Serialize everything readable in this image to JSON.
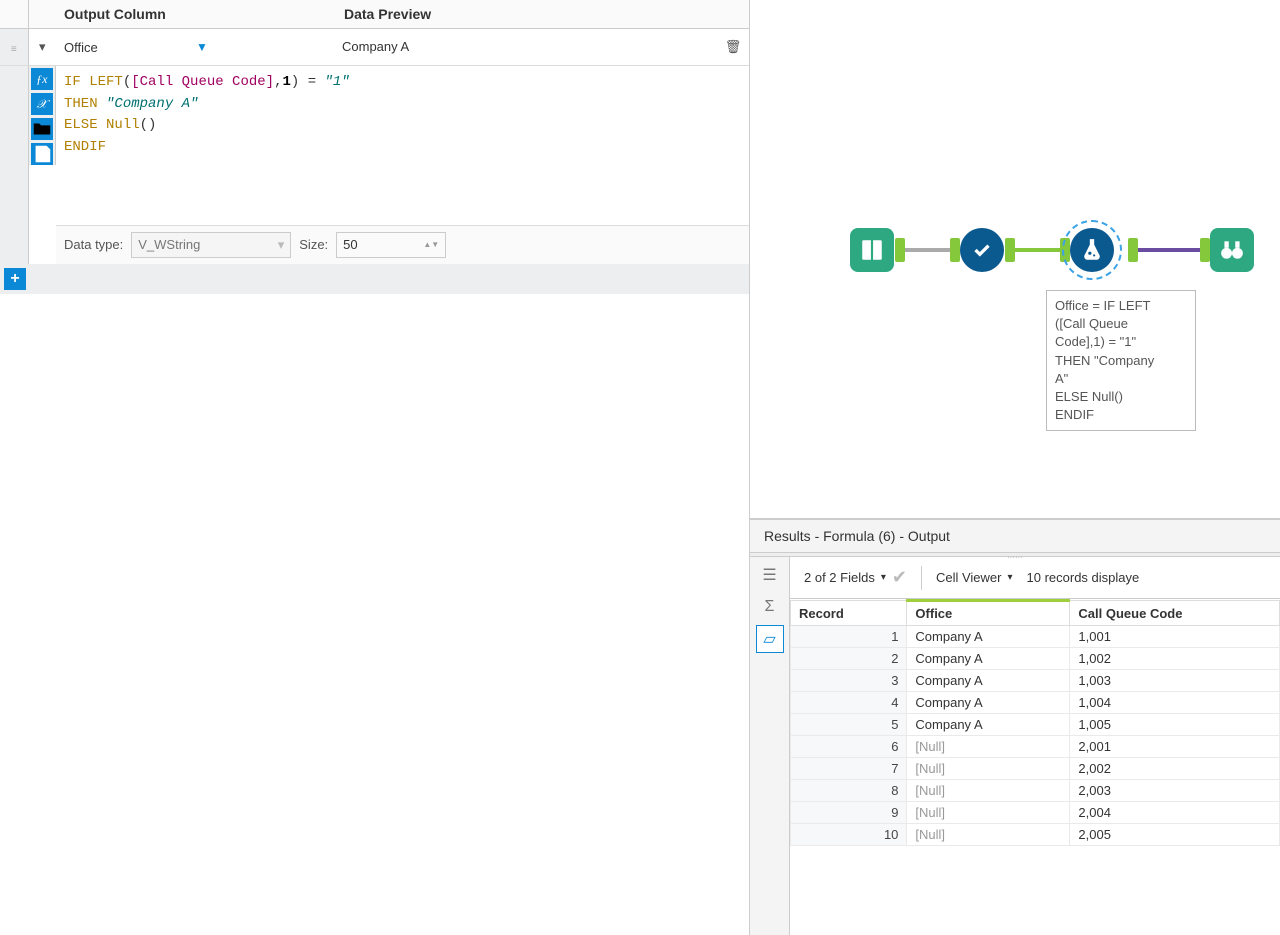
{
  "config": {
    "headers": {
      "output_column": "Output Column",
      "data_preview": "Data Preview"
    },
    "output_column_value": "Office",
    "data_preview_value": "Company A",
    "formula": {
      "kw_if": "IF",
      "fn_left": "LEFT",
      "field": "[Call Queue Code]",
      "comma": ",",
      "num1": "1",
      "eq": "=",
      "str1": "\"1\"",
      "kw_then": "THEN",
      "str_company": "\"Company A\"",
      "kw_else": "ELSE",
      "fn_null": "Null",
      "parens": "()",
      "kw_endif": "ENDIF"
    },
    "datatype_label": "Data type:",
    "datatype_value": "V_WString",
    "size_label": "Size:",
    "size_value": "50"
  },
  "canvas": {
    "annotation": "Office = IF LEFT([Call Queue Code],1) = \"1\"\nTHEN \"Company A\"\nELSE Null()\nENDIF",
    "anno_lines": [
      "Office = IF LEFT",
      "([Call Queue",
      "Code],1) = \"1\"",
      "THEN \"Company",
      "A\"",
      "ELSE Null()",
      "ENDIF"
    ]
  },
  "results": {
    "title": "Results - Formula (6) - Output",
    "fields_summary": "2 of 2 Fields",
    "cell_viewer": "Cell Viewer",
    "records_displayed": "10 records displaye",
    "columns": {
      "record": "Record",
      "office": "Office",
      "cqc": "Call Queue Code"
    },
    "rows": [
      {
        "rec": "1",
        "office": "Company A",
        "cqc": "1,001",
        "null": false
      },
      {
        "rec": "2",
        "office": "Company A",
        "cqc": "1,002",
        "null": false
      },
      {
        "rec": "3",
        "office": "Company A",
        "cqc": "1,003",
        "null": false
      },
      {
        "rec": "4",
        "office": "Company A",
        "cqc": "1,004",
        "null": false
      },
      {
        "rec": "5",
        "office": "Company A",
        "cqc": "1,005",
        "null": false
      },
      {
        "rec": "6",
        "office": "[Null]",
        "cqc": "2,001",
        "null": true
      },
      {
        "rec": "7",
        "office": "[Null]",
        "cqc": "2,002",
        "null": true
      },
      {
        "rec": "8",
        "office": "[Null]",
        "cqc": "2,003",
        "null": true
      },
      {
        "rec": "9",
        "office": "[Null]",
        "cqc": "2,004",
        "null": true
      },
      {
        "rec": "10",
        "office": "[Null]",
        "cqc": "2,005",
        "null": true
      }
    ]
  }
}
